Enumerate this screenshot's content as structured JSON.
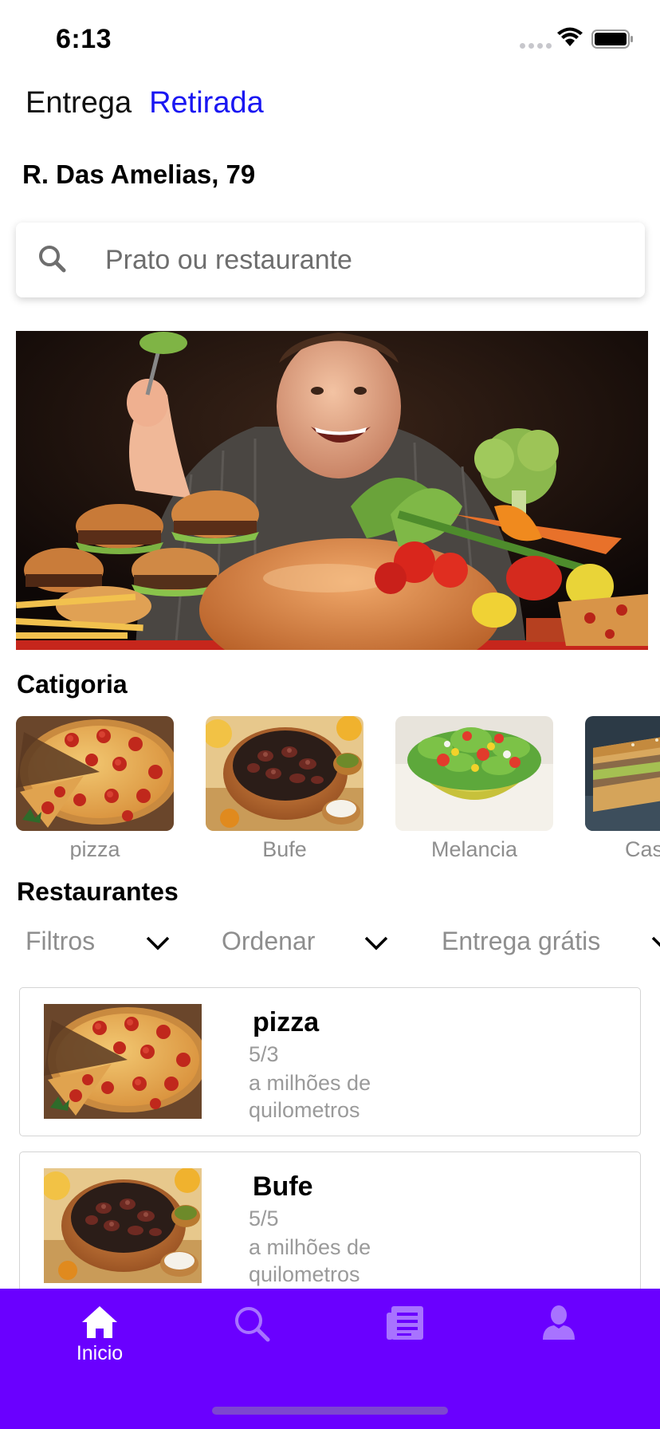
{
  "status_bar": {
    "time": "6:13"
  },
  "delivery_mode": {
    "options": [
      "Entrega",
      "Retirada"
    ],
    "selected": "Retirada"
  },
  "address": "R. Das Amelias, 79",
  "search": {
    "placeholder": "Prato ou restaurante",
    "value": ""
  },
  "categories": {
    "title": "Catigoria",
    "items": [
      {
        "label": "pizza",
        "image": "pizza"
      },
      {
        "label": "Bufe",
        "image": "feijoada"
      },
      {
        "label": "Melancia",
        "image": "salad"
      },
      {
        "label": "Cas",
        "image": "sandwich"
      }
    ]
  },
  "restaurants": {
    "title": "Restaurantes",
    "filters": [
      {
        "label": "Filtros",
        "icon": "chevron-down-icon"
      },
      {
        "label": "Ordenar",
        "icon": "chevron-down-icon"
      },
      {
        "label": "Entrega grátis",
        "icon": "chevron-down-icon"
      }
    ],
    "items": [
      {
        "name": "pizza",
        "rating": "5/3",
        "distance": "a milhões de quilometros",
        "image": "pizza"
      },
      {
        "name": "Bufe",
        "rating": "5/5",
        "distance": "a milhões de quilometros",
        "image": "feijoada"
      }
    ]
  },
  "tab_bar": {
    "background": "#6a00ff",
    "items": [
      {
        "label": "Inicio",
        "icon": "home-icon",
        "active": true
      },
      {
        "label": "",
        "icon": "search-icon",
        "active": false
      },
      {
        "label": "",
        "icon": "orders-icon",
        "active": false
      },
      {
        "label": "",
        "icon": "profile-icon",
        "active": false
      }
    ]
  }
}
